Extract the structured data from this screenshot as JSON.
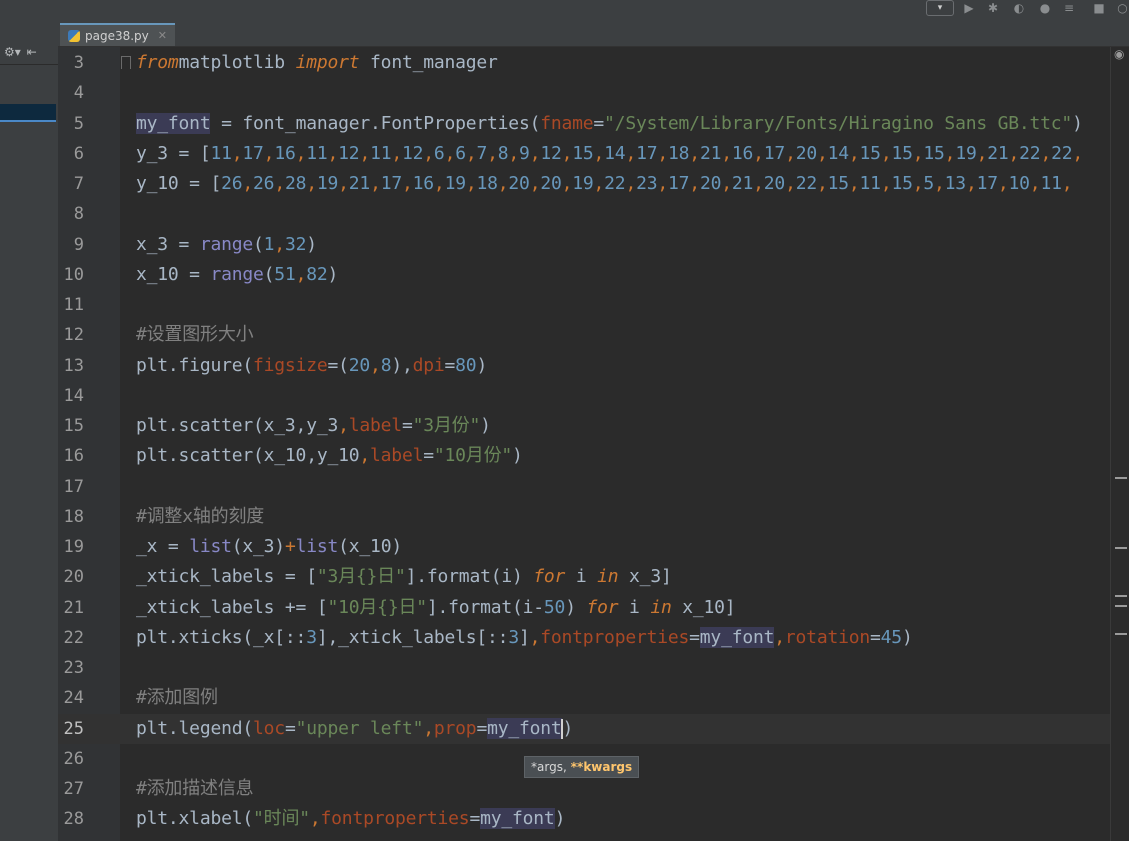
{
  "tab": {
    "filename": "page38.py"
  },
  "tooltip": {
    "args": "*args,",
    "kwargs": "**kwargs"
  },
  "lines": [
    {
      "n": "3",
      "parts": [
        [
          "kw",
          "from"
        ],
        [
          "",
          "matplotlib "
        ],
        [
          "kw",
          "import"
        ],
        [
          "",
          " font_manager"
        ]
      ]
    },
    {
      "n": "4",
      "parts": []
    },
    {
      "n": "5",
      "parts": [
        [
          "hl",
          "my_font"
        ],
        [
          "",
          " = font_manager.FontProperties("
        ],
        [
          "param",
          "fname"
        ],
        [
          "",
          "="
        ],
        [
          "str",
          "\"/System/Library/Fonts/Hiragino Sans GB.ttc\""
        ],
        [
          "",
          ")"
        ]
      ]
    },
    {
      "n": "6",
      "parts": [
        [
          "",
          "y_3 = ["
        ],
        [
          "num",
          "11"
        ],
        [
          "kwn",
          ","
        ],
        [
          "num",
          "17"
        ],
        [
          "kwn",
          ","
        ],
        [
          "num",
          "16"
        ],
        [
          "kwn",
          ","
        ],
        [
          "num",
          "11"
        ],
        [
          "kwn",
          ","
        ],
        [
          "num",
          "12"
        ],
        [
          "kwn",
          ","
        ],
        [
          "num",
          "11"
        ],
        [
          "kwn",
          ","
        ],
        [
          "num",
          "12"
        ],
        [
          "kwn",
          ","
        ],
        [
          "num",
          "6"
        ],
        [
          "kwn",
          ","
        ],
        [
          "num",
          "6"
        ],
        [
          "kwn",
          ","
        ],
        [
          "num",
          "7"
        ],
        [
          "kwn",
          ","
        ],
        [
          "num",
          "8"
        ],
        [
          "kwn",
          ","
        ],
        [
          "num",
          "9"
        ],
        [
          "kwn",
          ","
        ],
        [
          "num",
          "12"
        ],
        [
          "kwn",
          ","
        ],
        [
          "num",
          "15"
        ],
        [
          "kwn",
          ","
        ],
        [
          "num",
          "14"
        ],
        [
          "kwn",
          ","
        ],
        [
          "num",
          "17"
        ],
        [
          "kwn",
          ","
        ],
        [
          "num",
          "18"
        ],
        [
          "kwn",
          ","
        ],
        [
          "num",
          "21"
        ],
        [
          "kwn",
          ","
        ],
        [
          "num",
          "16"
        ],
        [
          "kwn",
          ","
        ],
        [
          "num",
          "17"
        ],
        [
          "kwn",
          ","
        ],
        [
          "num",
          "20"
        ],
        [
          "kwn",
          ","
        ],
        [
          "num",
          "14"
        ],
        [
          "kwn",
          ","
        ],
        [
          "num",
          "15"
        ],
        [
          "kwn",
          ","
        ],
        [
          "num",
          "15"
        ],
        [
          "kwn",
          ","
        ],
        [
          "num",
          "15"
        ],
        [
          "kwn",
          ","
        ],
        [
          "num",
          "19"
        ],
        [
          "kwn",
          ","
        ],
        [
          "num",
          "21"
        ],
        [
          "kwn",
          ","
        ],
        [
          "num",
          "22"
        ],
        [
          "kwn",
          ","
        ],
        [
          "num",
          "22"
        ],
        [
          "kwn",
          ","
        ]
      ]
    },
    {
      "n": "7",
      "parts": [
        [
          "",
          "y_10 = ["
        ],
        [
          "num",
          "26"
        ],
        [
          "kwn",
          ","
        ],
        [
          "num",
          "26"
        ],
        [
          "kwn",
          ","
        ],
        [
          "num",
          "28"
        ],
        [
          "kwn",
          ","
        ],
        [
          "num",
          "19"
        ],
        [
          "kwn",
          ","
        ],
        [
          "num",
          "21"
        ],
        [
          "kwn",
          ","
        ],
        [
          "num",
          "17"
        ],
        [
          "kwn",
          ","
        ],
        [
          "num",
          "16"
        ],
        [
          "kwn",
          ","
        ],
        [
          "num",
          "19"
        ],
        [
          "kwn",
          ","
        ],
        [
          "num",
          "18"
        ],
        [
          "kwn",
          ","
        ],
        [
          "num",
          "20"
        ],
        [
          "kwn",
          ","
        ],
        [
          "num",
          "20"
        ],
        [
          "kwn",
          ","
        ],
        [
          "num",
          "19"
        ],
        [
          "kwn",
          ","
        ],
        [
          "num",
          "22"
        ],
        [
          "kwn",
          ","
        ],
        [
          "num",
          "23"
        ],
        [
          "kwn",
          ","
        ],
        [
          "num",
          "17"
        ],
        [
          "kwn",
          ","
        ],
        [
          "num",
          "20"
        ],
        [
          "kwn",
          ","
        ],
        [
          "num",
          "21"
        ],
        [
          "kwn",
          ","
        ],
        [
          "num",
          "20"
        ],
        [
          "kwn",
          ","
        ],
        [
          "num",
          "22"
        ],
        [
          "kwn",
          ","
        ],
        [
          "num",
          "15"
        ],
        [
          "kwn",
          ","
        ],
        [
          "num",
          "11"
        ],
        [
          "kwn",
          ","
        ],
        [
          "num",
          "15"
        ],
        [
          "kwn",
          ","
        ],
        [
          "num",
          "5"
        ],
        [
          "kwn",
          ","
        ],
        [
          "num",
          "13"
        ],
        [
          "kwn",
          ","
        ],
        [
          "num",
          "17"
        ],
        [
          "kwn",
          ","
        ],
        [
          "num",
          "10"
        ],
        [
          "kwn",
          ","
        ],
        [
          "num",
          "11"
        ],
        [
          "kwn",
          ","
        ]
      ]
    },
    {
      "n": "8",
      "parts": []
    },
    {
      "n": "9",
      "parts": [
        [
          "",
          "x_3 = "
        ],
        [
          "bi",
          "range"
        ],
        [
          "",
          "("
        ],
        [
          "num",
          "1"
        ],
        [
          "kwn",
          ","
        ],
        [
          "num",
          "32"
        ],
        [
          "",
          ")"
        ]
      ]
    },
    {
      "n": "10",
      "parts": [
        [
          "",
          "x_10 = "
        ],
        [
          "bi",
          "range"
        ],
        [
          "",
          "("
        ],
        [
          "num",
          "51"
        ],
        [
          "kwn",
          ","
        ],
        [
          "num",
          "82"
        ],
        [
          "",
          ")"
        ]
      ]
    },
    {
      "n": "11",
      "parts": []
    },
    {
      "n": "12",
      "parts": [
        [
          "cmt",
          "#设置图形大小"
        ]
      ]
    },
    {
      "n": "13",
      "parts": [
        [
          "",
          "plt.figure("
        ],
        [
          "param",
          "figsize"
        ],
        [
          "",
          "=("
        ],
        [
          "num",
          "20"
        ],
        [
          "kwn",
          ","
        ],
        [
          "num",
          "8"
        ],
        [
          "",
          "),"
        ],
        [
          "param",
          "dpi"
        ],
        [
          "",
          "="
        ],
        [
          "num",
          "80"
        ],
        [
          "",
          ")"
        ]
      ]
    },
    {
      "n": "14",
      "parts": []
    },
    {
      "n": "15",
      "parts": [
        [
          "",
          "plt.scatter(x_3,y_3"
        ],
        [
          "kwn",
          ","
        ],
        [
          "param",
          "label"
        ],
        [
          "",
          "="
        ],
        [
          "str",
          "\"3月份\""
        ],
        [
          "",
          ")"
        ]
      ]
    },
    {
      "n": "16",
      "parts": [
        [
          "",
          "plt.scatter(x_10,y_10"
        ],
        [
          "kwn",
          ","
        ],
        [
          "param",
          "label"
        ],
        [
          "",
          "="
        ],
        [
          "str",
          "\"10月份\""
        ],
        [
          "",
          ")"
        ]
      ]
    },
    {
      "n": "17",
      "parts": []
    },
    {
      "n": "18",
      "parts": [
        [
          "cmt",
          "#调整x轴的刻度"
        ]
      ]
    },
    {
      "n": "19",
      "parts": [
        [
          "",
          "_x = "
        ],
        [
          "bi",
          "list"
        ],
        [
          "",
          "(x_3)"
        ],
        [
          "kwn",
          "+"
        ],
        [
          "bi",
          "list"
        ],
        [
          "",
          "(x_10)"
        ]
      ]
    },
    {
      "n": "20",
      "parts": [
        [
          "",
          "_xtick_labels = ["
        ],
        [
          "str",
          "\"3月{}日\""
        ],
        [
          "",
          "].format(i) "
        ],
        [
          "kw",
          "for"
        ],
        [
          "",
          " i "
        ],
        [
          "kw",
          "in"
        ],
        [
          "",
          " x_3]"
        ]
      ]
    },
    {
      "n": "21",
      "parts": [
        [
          "",
          "_xtick_labels += ["
        ],
        [
          "str",
          "\"10月{}日\""
        ],
        [
          "",
          "].format(i-"
        ],
        [
          "num",
          "50"
        ],
        [
          "",
          ") "
        ],
        [
          "kw",
          "for"
        ],
        [
          "",
          " i "
        ],
        [
          "kw",
          "in"
        ],
        [
          "",
          " x_10]"
        ]
      ]
    },
    {
      "n": "22",
      "parts": [
        [
          "",
          "plt.xticks(_x[::"
        ],
        [
          "num",
          "3"
        ],
        [
          "",
          "],_xtick_labels[::"
        ],
        [
          "num",
          "3"
        ],
        [
          "",
          "]"
        ],
        [
          "kwn",
          ","
        ],
        [
          "param",
          "fontproperties"
        ],
        [
          "",
          "="
        ],
        [
          "hl",
          "my_font"
        ],
        [
          "kwn",
          ","
        ],
        [
          "param",
          "rotation"
        ],
        [
          "",
          "="
        ],
        [
          "num",
          "45"
        ],
        [
          "",
          ")"
        ]
      ]
    },
    {
      "n": "23",
      "parts": []
    },
    {
      "n": "24",
      "parts": [
        [
          "cmt",
          "#添加图例"
        ]
      ]
    },
    {
      "n": "25",
      "parts": [
        [
          "",
          "plt.legend("
        ],
        [
          "param",
          "loc"
        ],
        [
          "",
          "="
        ],
        [
          "str",
          "\"upper left\""
        ],
        [
          "kwn",
          ","
        ],
        [
          "param",
          "prop"
        ],
        [
          "",
          "="
        ],
        [
          "hl",
          "my_font"
        ],
        [
          "",
          ")"
        ]
      ]
    },
    {
      "n": "26",
      "parts": []
    },
    {
      "n": "27",
      "parts": [
        [
          "cmt",
          "#添加描述信息"
        ]
      ]
    },
    {
      "n": "28",
      "parts": [
        [
          "",
          "plt.xlabel("
        ],
        [
          "str",
          "\"时间\""
        ],
        [
          "kwn",
          ","
        ],
        [
          "param",
          "fontproperties"
        ],
        [
          "",
          "="
        ],
        [
          "hl",
          "my_font"
        ],
        [
          "",
          ")"
        ]
      ]
    }
  ],
  "current_line": "25"
}
